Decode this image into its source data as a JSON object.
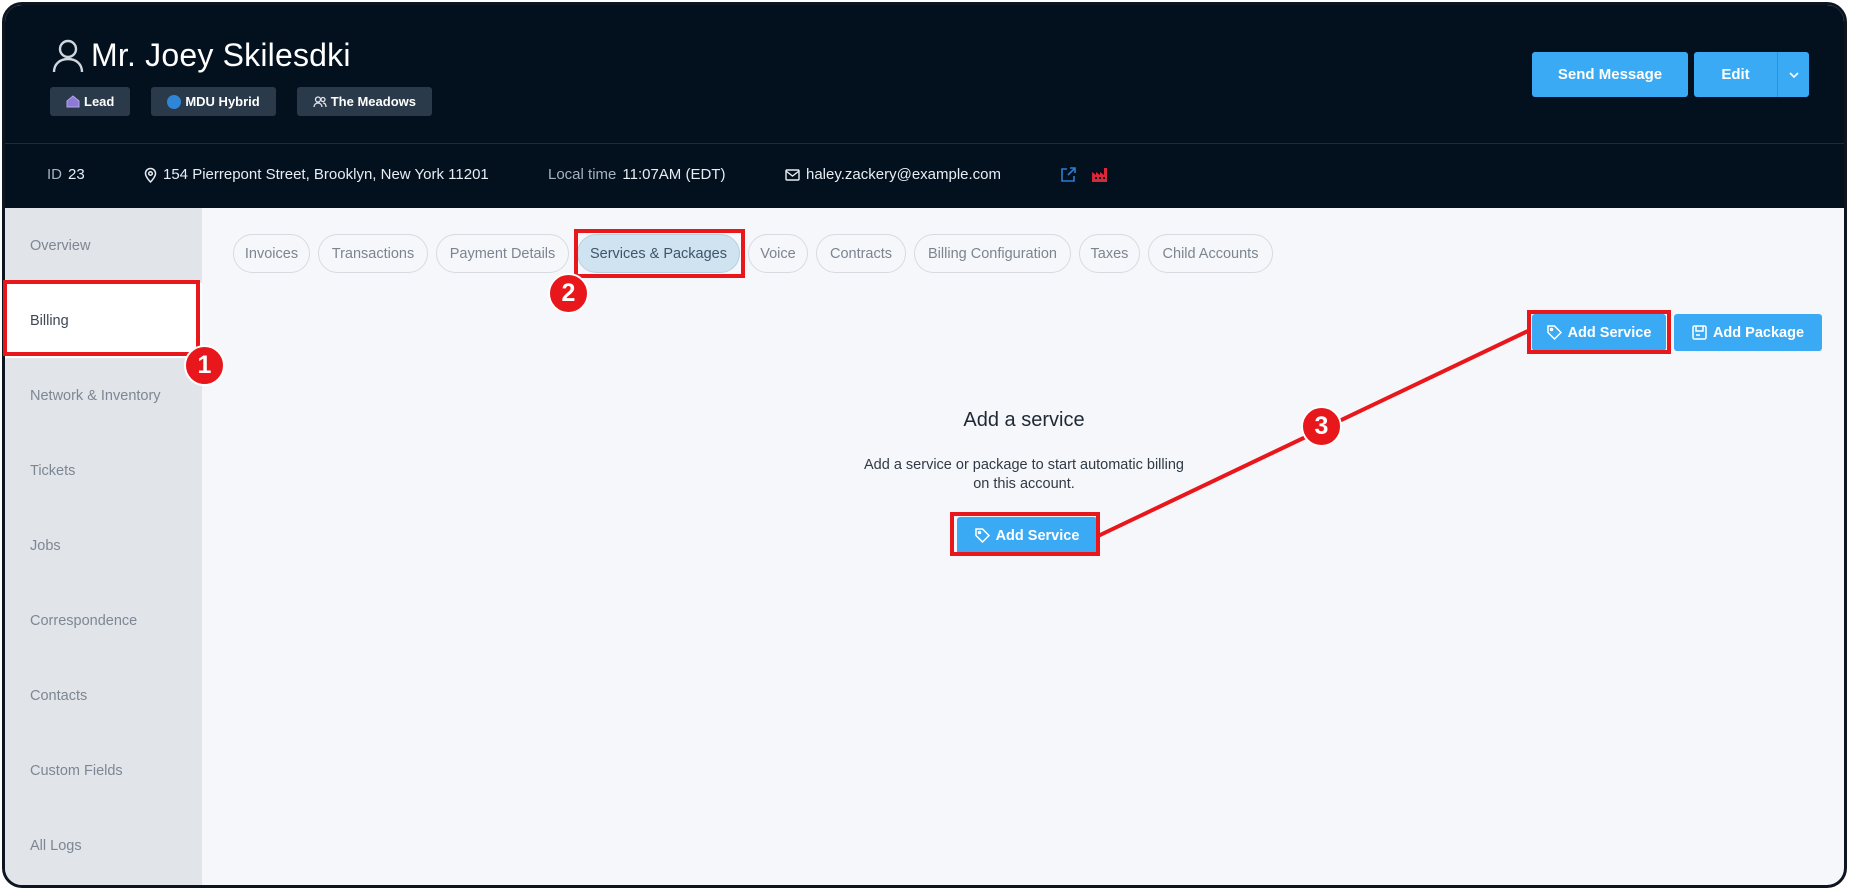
{
  "header": {
    "name": "Mr. Joey Skilesdki",
    "badges": [
      {
        "label": "Lead",
        "icon": "home-icon"
      },
      {
        "label": "MDU Hybrid",
        "icon": "circle-icon"
      },
      {
        "label": "The Meadows",
        "icon": "users-icon"
      }
    ],
    "send_message_label": "Send Message",
    "edit_label": "Edit"
  },
  "info": {
    "id_label": "ID",
    "id_value": "23",
    "address": "154 Pierrepont Street, Brooklyn, New York 11201",
    "local_time_label": "Local time",
    "local_time_value": "11:07AM (EDT)",
    "email": "haley.zackery@example.com"
  },
  "sidebar": {
    "items": [
      {
        "label": "Overview"
      },
      {
        "label": "Billing"
      },
      {
        "label": "Network & Inventory"
      },
      {
        "label": "Tickets"
      },
      {
        "label": "Jobs"
      },
      {
        "label": "Correspondence"
      },
      {
        "label": "Contacts"
      },
      {
        "label": "Custom Fields"
      },
      {
        "label": "All Logs"
      }
    ],
    "active": "Billing"
  },
  "tabs": [
    {
      "label": "Invoices"
    },
    {
      "label": "Transactions"
    },
    {
      "label": "Payment Details"
    },
    {
      "label": "Services & Packages"
    },
    {
      "label": "Voice"
    },
    {
      "label": "Contracts"
    },
    {
      "label": "Billing Configuration"
    },
    {
      "label": "Taxes"
    },
    {
      "label": "Child Accounts"
    }
  ],
  "active_tab": "Services & Packages",
  "actions": {
    "add_service_label": "Add Service",
    "add_package_label": "Add Package"
  },
  "empty_state": {
    "title": "Add a service",
    "description": "Add a service or package to start automatic billing on this account.",
    "button_label": "Add Service"
  },
  "annotations": [
    "1",
    "2",
    "3"
  ],
  "colors": {
    "header_bg": "#03111f",
    "accent": "#3aaaf5",
    "annotation": "#e8171b"
  }
}
